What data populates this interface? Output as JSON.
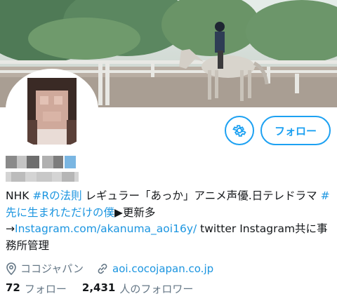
{
  "profile": {
    "follow_label": "フォロー",
    "bio": {
      "text1": "NHK ",
      "tag1": "#Rの法則",
      "text2": " レギュラー「あっか」アニメ声優.日テレドラマ ",
      "tag2": "#先に生まれただけの僕",
      "text3": "▶更新多\n→",
      "link": "Instagram.com/akanuma_aoi16y/",
      "text4": " twitter Instagram共に事務所管理"
    },
    "location": "ココジャパン",
    "website": "aoi.cocojapan.co.jp",
    "following_count": "72",
    "following_label": "フォロー",
    "followers_count": "2,431",
    "followers_label": "人のフォロワー"
  },
  "icons": {
    "settings": "gear-icon",
    "location": "location-pin-icon",
    "website": "link-icon"
  },
  "colors": {
    "accent": "#1da1f2",
    "link": "#1b95e0",
    "muted": "#657786"
  }
}
